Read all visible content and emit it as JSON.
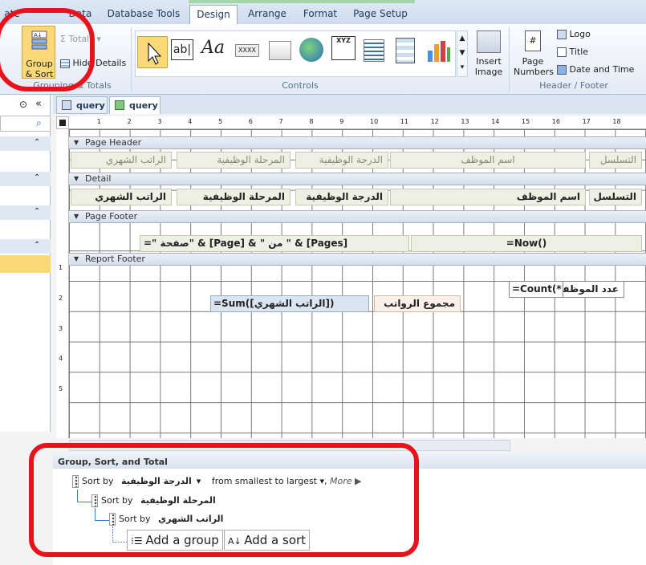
{
  "tabs": [
    {
      "label": "ate"
    },
    {
      "label": "Data"
    },
    {
      "label": "Database Tools"
    },
    {
      "label": "Design"
    },
    {
      "label": "Arrange"
    },
    {
      "label": "Format"
    },
    {
      "label": "Page Setup"
    }
  ],
  "ribbon": {
    "group_sort": {
      "label": "Group\n& Sort",
      "label_l1": "Group",
      "label_l2": "& Sort",
      "totals": "Totals",
      "hide_details": "Hide Details",
      "group_label": "Grouping & Totals"
    },
    "controls": {
      "group_label": "Controls",
      "items": [
        "select-arrow",
        "text-box",
        "label-aa",
        "button",
        "tab-control",
        "hyperlink",
        "web-browser",
        "navigation",
        "combo-box",
        "chart"
      ]
    },
    "insert_image": {
      "l1": "Insert",
      "l2": "Image"
    },
    "header_footer": {
      "page_numbers_l1": "Page",
      "page_numbers_l2": "Numbers",
      "logo": "Logo",
      "title": "Title",
      "date_time": "Date and Time",
      "group_label": "Header / Footer"
    }
  },
  "doc_tabs": [
    {
      "label": "query"
    },
    {
      "label": "query"
    }
  ],
  "ruler": {
    "marks": [
      "1",
      "2",
      "3",
      "4",
      "5",
      "6",
      "7",
      "8",
      "9",
      "10",
      "11",
      "12",
      "13",
      "14",
      "15",
      "16",
      "17",
      "18"
    ]
  },
  "vruler": {
    "marks": [
      "1",
      "2",
      "3",
      "4",
      "5"
    ]
  },
  "sections": {
    "page_header": "Page Header",
    "detail": "Detail",
    "page_footer": "Page Footer",
    "report_footer": "Report Footer"
  },
  "header_labels": [
    "الراتب الشهري",
    "المرحلة الوظيفية",
    "الدرجة الوظيفية",
    "اسم الموظف",
    "التسلسل"
  ],
  "detail_fields": [
    "الراتب الشهري",
    "المرحلة الوظيفية",
    "الدرجة الوظيفية",
    "اسم الموظف",
    "التسلسل"
  ],
  "footer": {
    "page_expr": "=\" صفحة\" & [Page] & \" من \" & [Pages]",
    "now_expr": "=Now()"
  },
  "report_footer": {
    "sum_expr": "=Sum([الراتب الشهري])",
    "sum_label": "مجموع الرواتب",
    "count_expr": "=Count(*)",
    "count_label": "عدد الموظفين"
  },
  "group_sort_panel": {
    "title": "Group, Sort, and Total",
    "rows": [
      {
        "sort_by": "Sort by",
        "field": "الدرجة الوظيفية",
        "order": "from smallest to largest",
        "more": "More ▶"
      },
      {
        "sort_by": "Sort by",
        "field": "المرحلة الوظيفية"
      },
      {
        "sort_by": "Sort by",
        "field": "الراتب الشهري"
      }
    ],
    "add_group": "Add a group",
    "add_sort": "Add a sort"
  },
  "colors": {
    "highlight": "#e8121c",
    "selected_button": "#fcd978"
  }
}
